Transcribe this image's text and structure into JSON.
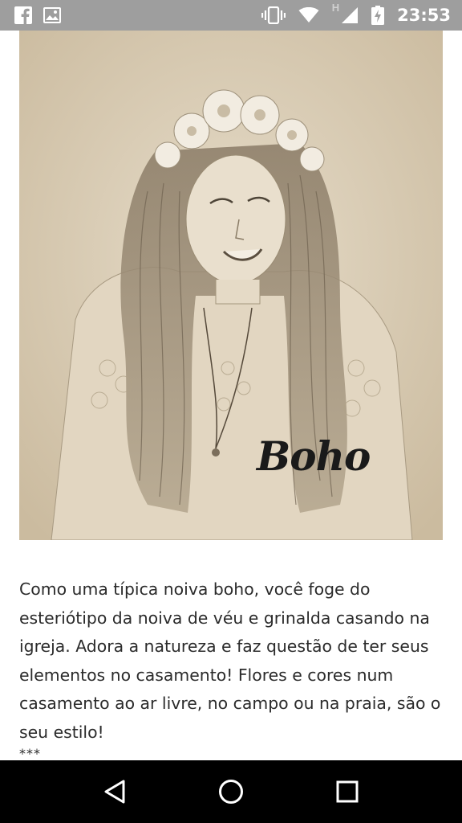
{
  "status_bar": {
    "time": "23:53",
    "network_letter": "H",
    "notification_icons": [
      "facebook-icon",
      "gallery-icon"
    ],
    "system_icons": [
      "vibrate-icon",
      "wifi-icon",
      "signal-icon",
      "battery-charging-icon"
    ]
  },
  "article": {
    "image_caption": "Boho",
    "paragraph": "Como uma típica noiva boho, você foge do esteriótipo da noiva de véu e grinalda casando na igreja. Adora a natureza e faz questão de ter seus elementos no casamento! Flores e cores num casamento ao ar livre, no campo ou na praia, são o seu estilo!",
    "separator": "***"
  },
  "navigation": {
    "buttons": [
      "back-icon",
      "home-icon",
      "recents-icon"
    ]
  },
  "colors": {
    "status_bar": "#9e9e9e",
    "nav_bar": "#000000",
    "image_background": "#d9cbb4",
    "text": "#2b2b2b"
  }
}
